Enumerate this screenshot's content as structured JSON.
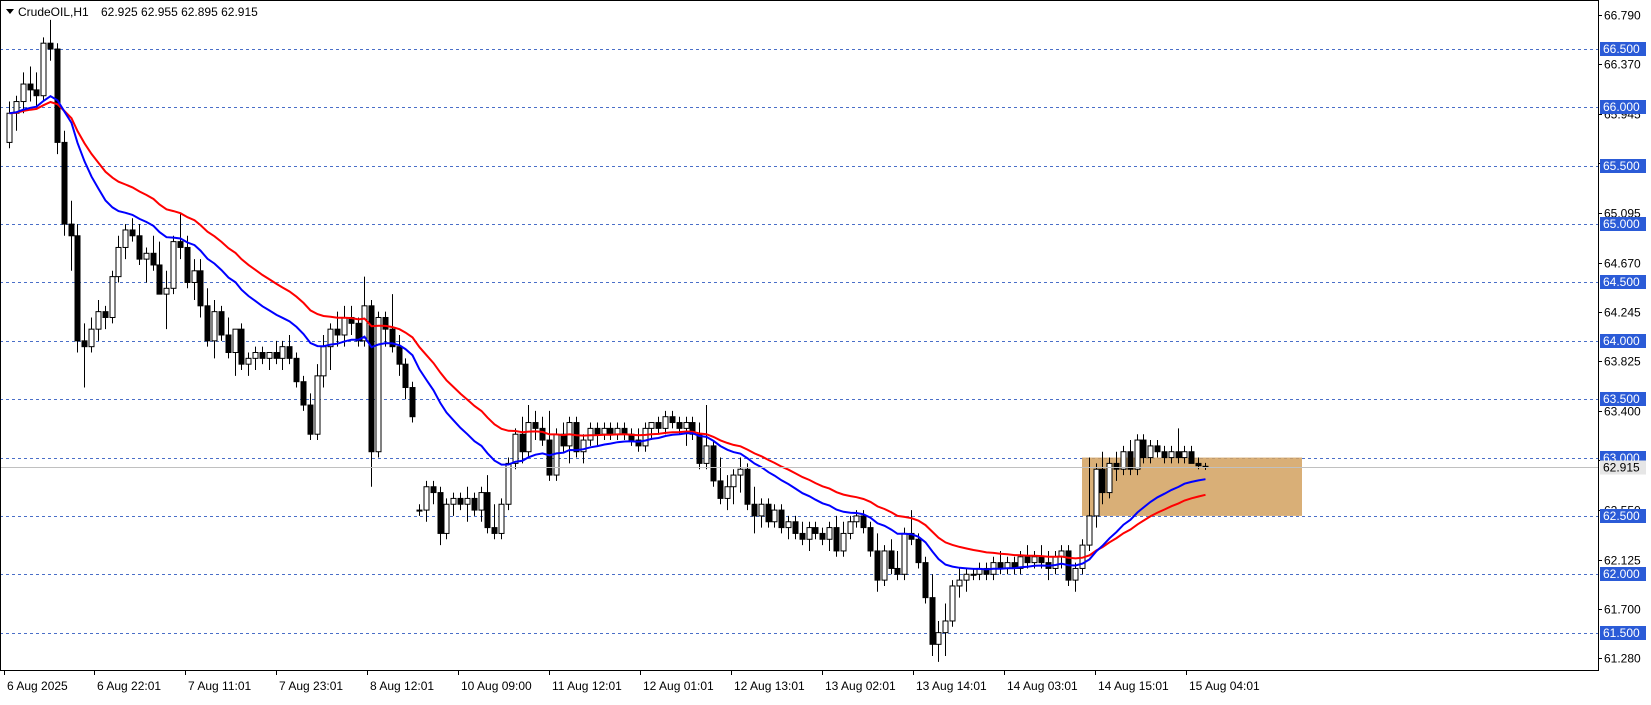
{
  "header": {
    "symbol_label": "CrudeOIL,H1",
    "ohlc_label": "62.925 62.955 62.895 62.915"
  },
  "chart_data": {
    "type": "candlestick",
    "symbol": "CrudeOIL",
    "timeframe": "H1",
    "current_price": 62.915,
    "ylim": [
      61.18,
      66.92
    ],
    "y_ticks": [
      "66.790",
      "66.370",
      "65.945",
      "65.520",
      "65.095",
      "64.670",
      "64.245",
      "63.825",
      "63.400",
      "62.975",
      "62.550",
      "62.125",
      "61.700",
      "61.280"
    ],
    "y_tick_values": [
      66.79,
      66.37,
      65.945,
      65.52,
      65.095,
      64.67,
      64.245,
      63.825,
      63.4,
      62.975,
      62.55,
      62.125,
      61.7,
      61.28
    ],
    "level_lines": [
      {
        "value": 66.5,
        "label": "66.500"
      },
      {
        "value": 66.0,
        "label": "66.000"
      },
      {
        "value": 65.5,
        "label": "65.500"
      },
      {
        "value": 65.0,
        "label": "65.000"
      },
      {
        "value": 64.5,
        "label": "64.500"
      },
      {
        "value": 64.0,
        "label": "64.000"
      },
      {
        "value": 63.5,
        "label": "63.500"
      },
      {
        "value": 63.0,
        "label": "63.000"
      },
      {
        "value": 62.5,
        "label": "62.500"
      },
      {
        "value": 62.0,
        "label": "62.000"
      },
      {
        "value": 61.5,
        "label": "61.500"
      }
    ],
    "x_labels": [
      "6 Aug 2025",
      "6 Aug 22:01",
      "7 Aug 11:01",
      "7 Aug 23:01",
      "8 Aug 12:01",
      "10 Aug 09:00",
      "11 Aug 12:01",
      "12 Aug 01:01",
      "12 Aug 13:01",
      "13 Aug 02:01",
      "13 Aug 14:01",
      "14 Aug 03:01",
      "14 Aug 15:01",
      "15 Aug 04:01"
    ],
    "zone": {
      "from_price": 62.5,
      "to_price": 63.0,
      "color": "#d2a15f"
    },
    "ma_fast_color": "#0000ff",
    "ma_slow_color": "#ff0000",
    "grid": false,
    "candles": [
      [
        65.7,
        66.05,
        65.65,
        65.95
      ],
      [
        65.95,
        66.1,
        65.8,
        66.05
      ],
      [
        66.05,
        66.3,
        65.95,
        66.2
      ],
      [
        66.2,
        66.35,
        66.05,
        66.15
      ],
      [
        66.15,
        66.3,
        66.0,
        66.1
      ],
      [
        66.1,
        66.6,
        66.05,
        66.55
      ],
      [
        66.55,
        66.75,
        66.4,
        66.5
      ],
      [
        66.5,
        66.55,
        65.6,
        65.7
      ],
      [
        65.7,
        65.8,
        64.9,
        65.0
      ],
      [
        65.0,
        65.2,
        64.6,
        64.9
      ],
      [
        64.9,
        65.0,
        63.9,
        64.0
      ],
      [
        64.0,
        64.15,
        63.6,
        63.95
      ],
      [
        63.95,
        64.2,
        63.9,
        64.1
      ],
      [
        64.1,
        64.35,
        64.0,
        64.25
      ],
      [
        64.25,
        64.3,
        64.1,
        64.2
      ],
      [
        64.2,
        64.6,
        64.15,
        64.55
      ],
      [
        64.55,
        64.9,
        64.5,
        64.8
      ],
      [
        64.8,
        65.0,
        64.7,
        64.95
      ],
      [
        64.95,
        65.05,
        64.85,
        64.9
      ],
      [
        64.9,
        65.0,
        64.65,
        64.7
      ],
      [
        64.7,
        64.8,
        64.5,
        64.75
      ],
      [
        64.75,
        64.9,
        64.6,
        64.65
      ],
      [
        64.65,
        64.85,
        64.45,
        64.4
      ],
      [
        64.4,
        64.6,
        64.1,
        64.45
      ],
      [
        64.45,
        64.9,
        64.4,
        64.85
      ],
      [
        64.85,
        65.1,
        64.7,
        64.8
      ],
      [
        64.8,
        64.9,
        64.45,
        64.5
      ],
      [
        64.5,
        64.7,
        64.35,
        64.6
      ],
      [
        64.6,
        64.7,
        64.2,
        64.3
      ],
      [
        64.3,
        64.45,
        63.95,
        64.0
      ],
      [
        64.0,
        64.35,
        63.85,
        64.25
      ],
      [
        64.25,
        64.3,
        64.0,
        64.05
      ],
      [
        64.05,
        64.2,
        63.85,
        63.9
      ],
      [
        63.9,
        64.1,
        63.7,
        64.1
      ],
      [
        64.1,
        64.15,
        63.75,
        63.8
      ],
      [
        63.8,
        63.9,
        63.7,
        63.85
      ],
      [
        63.85,
        63.95,
        63.75,
        63.9
      ],
      [
        63.9,
        63.95,
        63.8,
        63.85
      ],
      [
        63.85,
        63.9,
        63.75,
        63.9
      ],
      [
        63.9,
        64.0,
        63.8,
        63.85
      ],
      [
        63.85,
        64.0,
        63.75,
        63.95
      ],
      [
        63.95,
        64.05,
        63.8,
        63.85
      ],
      [
        63.85,
        63.9,
        63.6,
        63.65
      ],
      [
        63.65,
        63.7,
        63.4,
        63.45
      ],
      [
        63.45,
        63.55,
        63.15,
        63.2
      ],
      [
        63.2,
        63.8,
        63.15,
        63.7
      ],
      [
        63.7,
        64.05,
        63.6,
        63.95
      ],
      [
        63.95,
        64.15,
        63.75,
        64.1
      ],
      [
        64.1,
        64.25,
        63.95,
        64.05
      ],
      [
        64.05,
        64.3,
        63.95,
        64.2
      ],
      [
        64.2,
        64.3,
        64.05,
        64.15
      ],
      [
        64.15,
        64.2,
        63.95,
        64.0
      ],
      [
        64.0,
        64.55,
        63.95,
        64.3
      ],
      [
        64.3,
        64.35,
        62.75,
        63.05
      ],
      [
        63.05,
        64.25,
        63.0,
        64.2
      ],
      [
        64.2,
        64.25,
        63.95,
        64.1
      ],
      [
        64.1,
        64.4,
        63.9,
        63.95
      ],
      [
        63.95,
        64.05,
        63.7,
        63.8
      ],
      [
        63.8,
        63.85,
        63.5,
        63.6
      ],
      [
        63.6,
        63.65,
        63.3,
        63.35
      ],
      [
        62.55,
        62.6,
        62.5,
        62.55
      ],
      [
        62.55,
        62.8,
        62.45,
        62.75
      ],
      [
        62.75,
        62.8,
        62.6,
        62.7
      ],
      [
        62.7,
        62.75,
        62.25,
        62.35
      ],
      [
        62.35,
        62.65,
        62.3,
        62.6
      ],
      [
        62.6,
        62.7,
        62.5,
        62.65
      ],
      [
        62.65,
        62.7,
        62.55,
        62.6
      ],
      [
        62.6,
        62.75,
        62.45,
        62.65
      ],
      [
        62.65,
        62.7,
        62.5,
        62.55
      ],
      [
        62.55,
        62.75,
        62.45,
        62.7
      ],
      [
        62.7,
        62.85,
        62.35,
        62.4
      ],
      [
        62.4,
        62.6,
        62.3,
        62.35
      ],
      [
        62.35,
        62.65,
        62.3,
        62.6
      ],
      [
        62.6,
        63.0,
        62.55,
        62.95
      ],
      [
        62.95,
        63.25,
        62.9,
        63.2
      ],
      [
        63.2,
        63.35,
        62.95,
        63.05
      ],
      [
        63.05,
        63.45,
        63.0,
        63.3
      ],
      [
        63.3,
        63.4,
        63.15,
        63.25
      ],
      [
        63.25,
        63.35,
        63.1,
        63.15
      ],
      [
        63.15,
        63.4,
        62.8,
        62.85
      ],
      [
        62.85,
        63.25,
        62.8,
        63.2
      ],
      [
        63.2,
        63.3,
        63.05,
        63.1
      ],
      [
        63.1,
        63.35,
        62.95,
        63.3
      ],
      [
        63.3,
        63.35,
        63.0,
        63.05
      ],
      [
        63.05,
        63.2,
        62.95,
        63.15
      ],
      [
        63.15,
        63.3,
        63.1,
        63.25
      ],
      [
        63.25,
        63.3,
        63.1,
        63.2
      ],
      [
        63.2,
        63.3,
        63.15,
        63.25
      ],
      [
        63.25,
        63.3,
        63.15,
        63.2
      ],
      [
        63.2,
        63.3,
        63.15,
        63.25
      ],
      [
        63.25,
        63.3,
        63.15,
        63.2
      ],
      [
        63.2,
        63.25,
        63.1,
        63.15
      ],
      [
        63.15,
        63.25,
        63.05,
        63.1
      ],
      [
        63.1,
        63.3,
        63.05,
        63.25
      ],
      [
        63.25,
        63.3,
        63.15,
        63.3
      ],
      [
        63.3,
        63.35,
        63.2,
        63.25
      ],
      [
        63.25,
        63.4,
        63.2,
        63.35
      ],
      [
        63.35,
        63.4,
        63.25,
        63.3
      ],
      [
        63.3,
        63.35,
        63.2,
        63.25
      ],
      [
        63.25,
        63.35,
        63.1,
        63.3
      ],
      [
        63.3,
        63.35,
        63.15,
        63.2
      ],
      [
        63.2,
        63.3,
        62.9,
        62.95
      ],
      [
        62.95,
        63.45,
        62.9,
        63.1
      ],
      [
        63.1,
        63.15,
        62.75,
        62.8
      ],
      [
        62.8,
        63.0,
        62.6,
        62.65
      ],
      [
        62.65,
        62.85,
        62.55,
        62.75
      ],
      [
        62.75,
        62.9,
        62.6,
        62.85
      ],
      [
        62.85,
        63.0,
        62.7,
        62.9
      ],
      [
        62.9,
        62.95,
        62.55,
        62.6
      ],
      [
        62.6,
        62.75,
        62.35,
        62.5
      ],
      [
        62.5,
        62.65,
        62.4,
        62.6
      ],
      [
        62.6,
        62.65,
        62.4,
        62.45
      ],
      [
        62.45,
        62.6,
        62.4,
        62.55
      ],
      [
        62.55,
        62.6,
        62.35,
        62.4
      ],
      [
        62.4,
        62.5,
        62.3,
        62.45
      ],
      [
        62.45,
        62.5,
        62.3,
        62.35
      ],
      [
        62.35,
        62.45,
        62.25,
        62.3
      ],
      [
        62.3,
        62.45,
        62.2,
        62.4
      ],
      [
        62.4,
        62.45,
        62.3,
        62.35
      ],
      [
        62.35,
        62.4,
        62.25,
        62.3
      ],
      [
        62.3,
        62.45,
        62.2,
        62.4
      ],
      [
        62.4,
        62.5,
        62.15,
        62.2
      ],
      [
        62.2,
        62.45,
        62.15,
        62.35
      ],
      [
        62.35,
        62.5,
        62.3,
        62.45
      ],
      [
        62.45,
        62.55,
        62.4,
        62.5
      ],
      [
        62.5,
        62.55,
        62.35,
        62.4
      ],
      [
        62.4,
        62.45,
        62.15,
        62.2
      ],
      [
        62.2,
        62.35,
        61.85,
        61.95
      ],
      [
        61.95,
        62.25,
        61.9,
        62.2
      ],
      [
        62.2,
        62.3,
        62.0,
        62.05
      ],
      [
        62.05,
        62.2,
        61.95,
        62.0
      ],
      [
        62.0,
        62.4,
        61.95,
        62.35
      ],
      [
        62.35,
        62.55,
        62.25,
        62.3
      ],
      [
        62.3,
        62.35,
        62.05,
        62.1
      ],
      [
        62.1,
        62.15,
        61.75,
        61.8
      ],
      [
        61.8,
        62.0,
        61.3,
        61.4
      ],
      [
        61.4,
        61.6,
        61.25,
        61.5
      ],
      [
        61.5,
        61.75,
        61.3,
        61.6
      ],
      [
        61.6,
        61.95,
        61.55,
        61.9
      ],
      [
        61.9,
        62.05,
        61.8,
        61.95
      ],
      [
        61.95,
        62.05,
        61.85,
        62.0
      ],
      [
        62.0,
        62.05,
        61.95,
        62.0
      ],
      [
        62.0,
        62.1,
        61.95,
        62.05
      ],
      [
        62.05,
        62.1,
        61.95,
        62.0
      ],
      [
        62.0,
        62.15,
        61.95,
        62.1
      ],
      [
        62.1,
        62.2,
        62.0,
        62.05
      ],
      [
        62.05,
        62.15,
        62.0,
        62.1
      ],
      [
        62.1,
        62.15,
        62.0,
        62.05
      ],
      [
        62.05,
        62.2,
        62.0,
        62.15
      ],
      [
        62.15,
        62.25,
        62.05,
        62.1
      ],
      [
        62.1,
        62.2,
        62.05,
        62.15
      ],
      [
        62.15,
        62.25,
        62.05,
        62.1
      ],
      [
        62.1,
        62.2,
        61.95,
        62.05
      ],
      [
        62.05,
        62.2,
        62.0,
        62.15
      ],
      [
        62.15,
        62.25,
        62.05,
        62.2
      ],
      [
        62.2,
        62.25,
        61.9,
        61.95
      ],
      [
        61.95,
        62.1,
        61.85,
        62.05
      ],
      [
        62.05,
        62.3,
        62.0,
        62.25
      ],
      [
        62.25,
        63.0,
        62.2,
        62.5
      ],
      [
        62.5,
        62.95,
        62.4,
        62.9
      ],
      [
        62.9,
        63.05,
        62.6,
        62.7
      ],
      [
        62.7,
        63.0,
        62.65,
        62.95
      ],
      [
        62.95,
        63.05,
        62.8,
        62.9
      ],
      [
        62.9,
        63.1,
        62.85,
        63.05
      ],
      [
        63.05,
        63.15,
        62.85,
        62.9
      ],
      [
        62.9,
        63.2,
        62.85,
        63.15
      ],
      [
        63.15,
        63.2,
        62.95,
        63.0
      ],
      [
        63.0,
        63.15,
        62.95,
        63.1
      ],
      [
        63.1,
        63.15,
        63.0,
        63.05
      ],
      [
        63.05,
        63.1,
        62.95,
        63.0
      ],
      [
        63.0,
        63.1,
        62.95,
        63.05
      ],
      [
        63.05,
        63.25,
        62.95,
        63.0
      ],
      [
        63.0,
        63.1,
        62.95,
        63.05
      ],
      [
        63.05,
        63.1,
        62.95,
        62.95
      ],
      [
        62.95,
        63.0,
        62.9,
        62.93
      ],
      [
        62.925,
        62.955,
        62.895,
        62.915
      ]
    ]
  }
}
